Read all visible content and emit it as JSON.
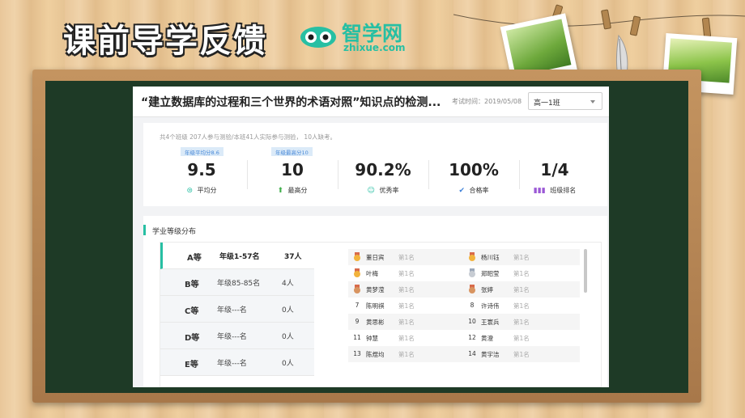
{
  "header": {
    "title": "课前导学反馈",
    "logo_cn": "智学网",
    "logo_en": "zhixue.com"
  },
  "colors": {
    "accent": "#27bfa3",
    "tag_bg": "#dbeaf8",
    "tag_text": "#4a8ad8",
    "board": "#1e3a26"
  },
  "exam": {
    "title": "“建立数据库的过程和三个世界的术语对照”知识点的检测...",
    "date": "考试时间：2019/05/08",
    "class_selected": "高一1班"
  },
  "summary": {
    "text": "共4个班级 207人参与测验/本班41人实际参与测验， 10人缺考。",
    "stats": [
      {
        "tag": "年级平均分8.6",
        "value": "9.5",
        "label": "平均分",
        "icon": "average-icon"
      },
      {
        "tag": "年级最高分10",
        "value": "10",
        "label": "最高分",
        "icon": "up-arrow-icon"
      },
      {
        "tag": "",
        "value": "90.2%",
        "label": "优秀率",
        "icon": "smile-icon"
      },
      {
        "tag": "",
        "value": "100%",
        "label": "合格率",
        "icon": "check-icon"
      },
      {
        "tag": "",
        "value": "1/4",
        "label": "班级排名",
        "icon": "bar-chart-icon"
      }
    ]
  },
  "distribution": {
    "title": "学业等级分布",
    "levels": [
      {
        "level": "A等",
        "range": "年级1-57名",
        "count": "37人"
      },
      {
        "level": "B等",
        "range": "年级85-85名",
        "count": "4人"
      },
      {
        "level": "C等",
        "range": "年级---名",
        "count": "0人"
      },
      {
        "level": "D等",
        "range": "年级---名",
        "count": "0人"
      },
      {
        "level": "E等",
        "range": "年级---名",
        "count": "0人"
      }
    ],
    "students": [
      {
        "rank": "",
        "medal": "gold",
        "name": "董日宾",
        "place": "第1名"
      },
      {
        "rank": "",
        "medal": "gold",
        "name": "杨川钰",
        "place": "第1名"
      },
      {
        "rank": "",
        "medal": "gold",
        "name": "叶梅",
        "place": "第1名"
      },
      {
        "rank": "",
        "medal": "silver",
        "name": "郑昭莹",
        "place": "第1名"
      },
      {
        "rank": "",
        "medal": "bronze",
        "name": "黄梦滢",
        "place": "第1名"
      },
      {
        "rank": "",
        "medal": "bronze",
        "name": "张婷",
        "place": "第1名"
      },
      {
        "rank": "7",
        "medal": "",
        "name": "陈明祺",
        "place": "第1名"
      },
      {
        "rank": "8",
        "medal": "",
        "name": "许诗伟",
        "place": "第1名"
      },
      {
        "rank": "9",
        "medal": "",
        "name": "黄思彬",
        "place": "第1名"
      },
      {
        "rank": "10",
        "medal": "",
        "name": "王寰兵",
        "place": "第1名"
      },
      {
        "rank": "11",
        "medal": "",
        "name": "钟慧",
        "place": "第1名"
      },
      {
        "rank": "12",
        "medal": "",
        "name": "黄澄",
        "place": "第1名"
      },
      {
        "rank": "13",
        "medal": "",
        "name": "陈煜均",
        "place": "第1名"
      },
      {
        "rank": "14",
        "medal": "",
        "name": "黄宇洁",
        "place": "第1名"
      }
    ]
  }
}
